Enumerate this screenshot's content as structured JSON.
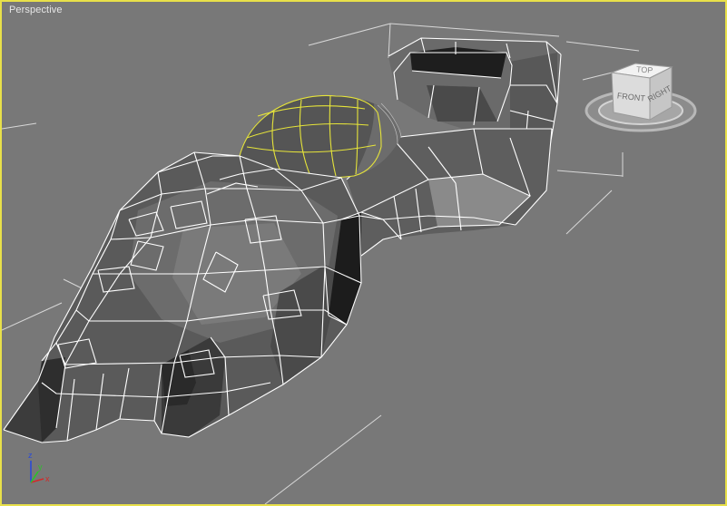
{
  "viewport": {
    "label": "Perspective",
    "frame_color": "#e8e04a",
    "background_color": "#787878",
    "wire_color": "#ffffff",
    "selected_wire_color": "#e6e43a"
  },
  "viewcube": {
    "top_label": "TOP",
    "front_label": "FRONT",
    "right_label": "RIGHT",
    "icon": "viewcube-icon"
  },
  "axis_tripod": {
    "x_label": "x",
    "y_label": "y",
    "z_label": "z",
    "x_color": "#d22",
    "y_color": "#2c2",
    "z_color": "#24d"
  }
}
